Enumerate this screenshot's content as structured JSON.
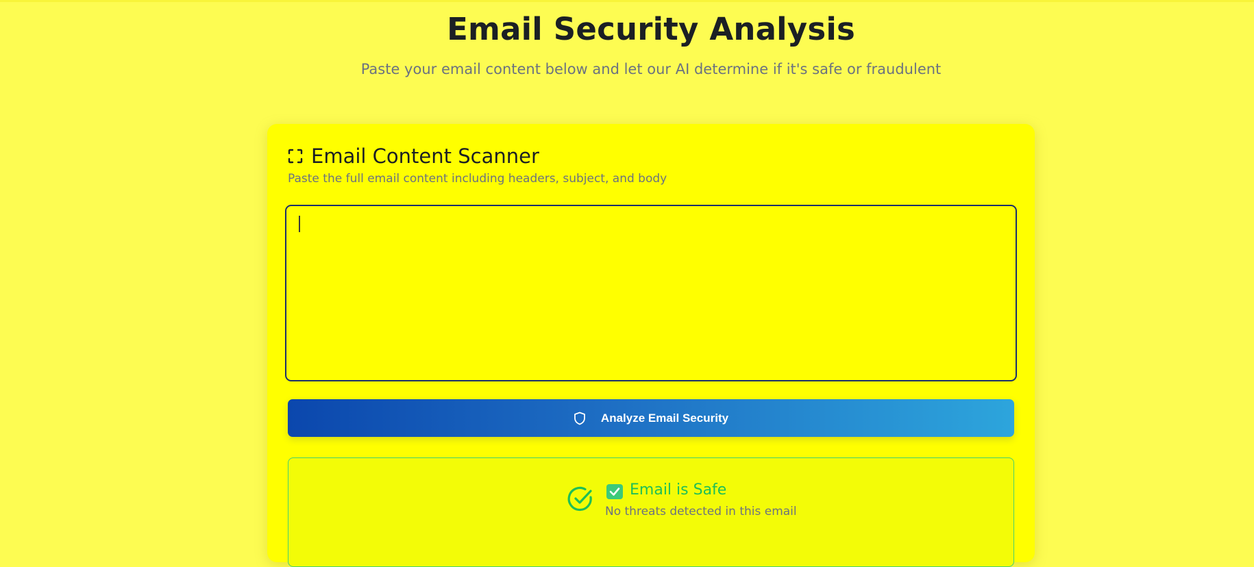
{
  "header": {
    "title": "Email Security Analysis",
    "subtitle": "Paste your email content below and let our AI determine if it's safe or fraudulent"
  },
  "scanner": {
    "icon": "scan-icon",
    "title": "Email Content Scanner",
    "description": "Paste the full email content including headers, subject, and body",
    "input_value": "",
    "input_placeholder": ""
  },
  "analyze_button": {
    "icon": "shield-icon",
    "label": "Analyze Email Security"
  },
  "result": {
    "icon": "check-circle-icon",
    "badge_icon": "checkbox-check-icon",
    "title": "Email is Safe",
    "text": "No threats detected in this email"
  },
  "colors": {
    "background": "#fdfc52",
    "card": "#ffff00",
    "button_gradient_start": "#0b47ad",
    "button_gradient_end": "#2da5dc",
    "safe_green": "#1fbf57"
  }
}
